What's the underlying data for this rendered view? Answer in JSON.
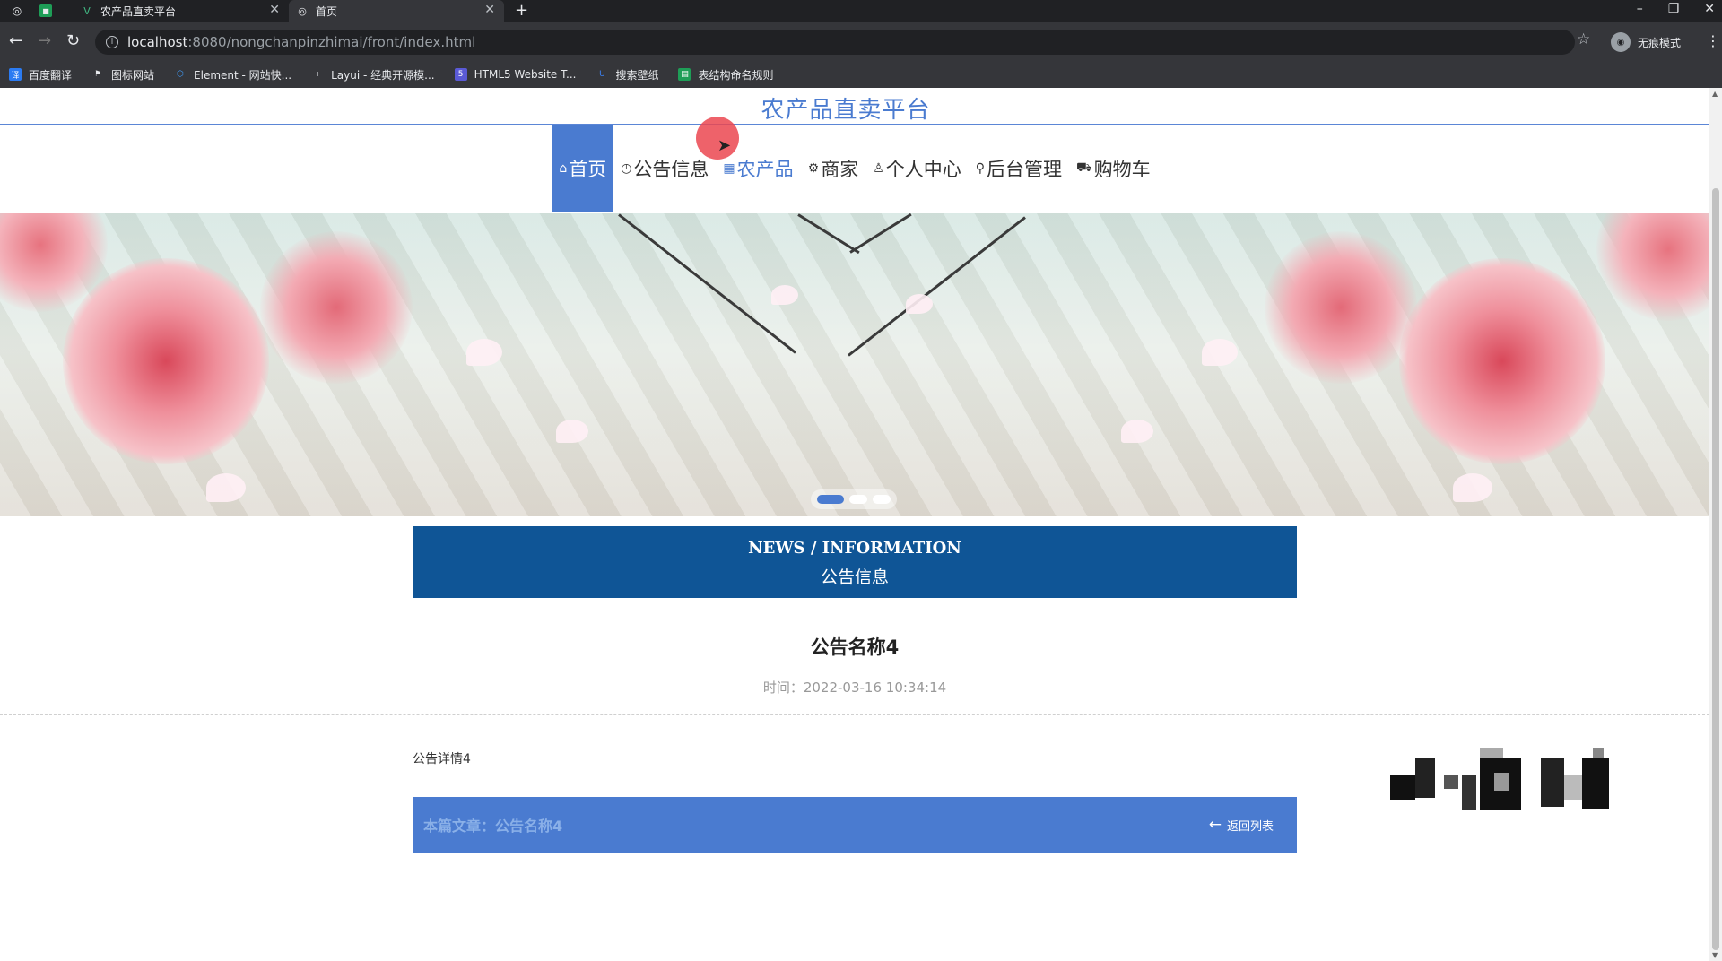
{
  "browser": {
    "tabs": [
      {
        "title": "农产品直卖平台",
        "active": false
      },
      {
        "title": "首页",
        "active": true
      }
    ],
    "new_tab_label": "+",
    "url_host": "localhost",
    "url_rest": ":8080/nongchanpinzhimai/front/index.html",
    "profile_label": "无痕模式",
    "bookmarks": [
      {
        "label": "百度翻译",
        "icon": "translate-icon",
        "color": "#2b7bf2"
      },
      {
        "label": "图标网站",
        "icon": "flag-icon",
        "color": "#e8eaed"
      },
      {
        "label": "Element - 网站快...",
        "icon": "hex-icon",
        "color": "#409eff"
      },
      {
        "label": "Layui - 经典开源模...",
        "icon": "layui-icon",
        "color": "#e8eaed"
      },
      {
        "label": "HTML5 Website T...",
        "icon": "html5-icon",
        "color": "#5a5ad6"
      },
      {
        "label": "搜索壁纸",
        "icon": "wallpaper-icon",
        "color": "#3b82f6"
      },
      {
        "label": "表结构命名规则",
        "icon": "sheet-icon",
        "color": "#1e9e57"
      }
    ]
  },
  "site": {
    "title": "农产品直卖平台",
    "brand_color": "#4a7bd0",
    "nav": [
      {
        "label": "首页",
        "icon": "home-icon",
        "glyph": "⌂",
        "active": true
      },
      {
        "label": "公告信息",
        "icon": "clock-icon",
        "glyph": "◷",
        "active": false
      },
      {
        "label": "农产品",
        "icon": "grid-icon",
        "glyph": "▦",
        "active": false,
        "hover": true
      },
      {
        "label": "商家",
        "icon": "gear-icon",
        "glyph": "⚙",
        "active": false
      },
      {
        "label": "个人中心",
        "icon": "user-icon",
        "glyph": "♙",
        "active": false
      },
      {
        "label": "后台管理",
        "icon": "link-icon",
        "glyph": "⚲",
        "active": false
      },
      {
        "label": "购物车",
        "icon": "cart-icon",
        "glyph": "⛟",
        "active": false
      }
    ],
    "carousel": {
      "slides": 3,
      "active_index": 0
    }
  },
  "news": {
    "header_en": "NEWS / INFORMATION",
    "header_cn": "公告信息",
    "header_color": "#0f5596"
  },
  "article": {
    "title": "公告名称4",
    "time": "时间：2022-03-16 10:34:14",
    "body": "公告详情4",
    "current_label": "本篇文章：公告名称4",
    "back_label": "返回列表"
  }
}
